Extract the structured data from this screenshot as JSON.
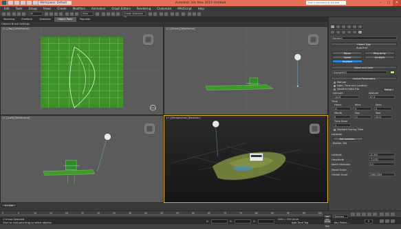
{
  "titlebar": {
    "title": "Autodesk 3ds Max  2015    Untitled",
    "workspace": "Workspace: Default",
    "search_placeholder": "Type a keyword or phrase",
    "minimize": "–",
    "maximize": "□",
    "close": "✕"
  },
  "menu": [
    "Edit",
    "Tools",
    "Group",
    "Views",
    "Create",
    "Modifiers",
    "Animation",
    "Graph Editors",
    "Rendering",
    "Customize",
    "MAXScript",
    "Help"
  ],
  "toolbar": {
    "selection_filter": "All",
    "view_dropdown": "View",
    "create_selection": "Create Selection Se"
  },
  "ribbon_tabs": [
    "Modeling",
    "Freeform",
    "Selection",
    "Object Paint",
    "Populate"
  ],
  "ribbon_active": "Object Paint",
  "subbar": "Objects Brush Settings",
  "viewports": {
    "top": "[+] [Top] [Wireframe]",
    "front": "[+] [Front] [Wireframe]",
    "left": "[+] [Left] [Wireframe]",
    "perspective": "[+] [Perspective] [Realistic]"
  },
  "command_panel": {
    "dropdown": "Standard",
    "object_type_header": "Object Type",
    "autogrid": "AutoGrid",
    "buttons": [
      "Biped",
      "Ring Array",
      "Speed",
      "Sunlight",
      "Daylight"
    ],
    "active_button": "Daylight",
    "name_color_header": "Name and Color",
    "object_name": "Daylight001",
    "control_params_header": "Control Parameters",
    "location_options": [
      "Manual",
      "Date, Time and Location",
      "Weather Data File"
    ],
    "location_selected": "Date, Time and Location",
    "setup_label": "Setup...",
    "azimuth_label": "Azimuth",
    "altitude_label": "Altitude",
    "azimuth_value": "144.8",
    "altitude_value": "67.4",
    "time_header": "Time",
    "time_labels": [
      "Hours",
      "Mins.",
      "Secs."
    ],
    "time_values": [
      "12",
      "0",
      "0"
    ],
    "date_labels": [
      "Month",
      "Day",
      "Year"
    ],
    "date_values": [
      "6",
      "21",
      "2014"
    ],
    "timezone_label": "Time Zone",
    "timezone_value": "-5",
    "dst_label": "Daylight Saving Time",
    "location_header": "Location",
    "get_location": "Get Location...",
    "city": "Boston, MA",
    "latitude_label": "Latitude",
    "latitude_value": "42.355",
    "longitude_label": "Longitude",
    "longitude_value": "-71.052",
    "north_label": "North Direction",
    "north_value": "0.0",
    "model_scale_header": "Model Scale",
    "orbital_label": "Orbital Scale",
    "orbital_value": "2968.2089"
  },
  "timeline": {
    "frame_display": "0 / 100",
    "ticks": [
      "0",
      "5",
      "10",
      "15",
      "20",
      "25",
      "30",
      "35",
      "40",
      "45",
      "50",
      "55",
      "60",
      "65",
      "70",
      "75",
      "80",
      "85",
      "90",
      "95",
      "100"
    ]
  },
  "status": {
    "selection": "1 Group Selected",
    "prompt": "Click or click-and-drag to select objects",
    "x_label": "X:",
    "y_label": "Y:",
    "z_label": "Z:",
    "grid": "Grid = 254.0mm",
    "autokey": "Auto Key",
    "selected": "Selected",
    "set_key": "Set Key",
    "key_filters": "Key Filters...",
    "add_time_tag": "Add Time Tag",
    "frame": "0"
  }
}
